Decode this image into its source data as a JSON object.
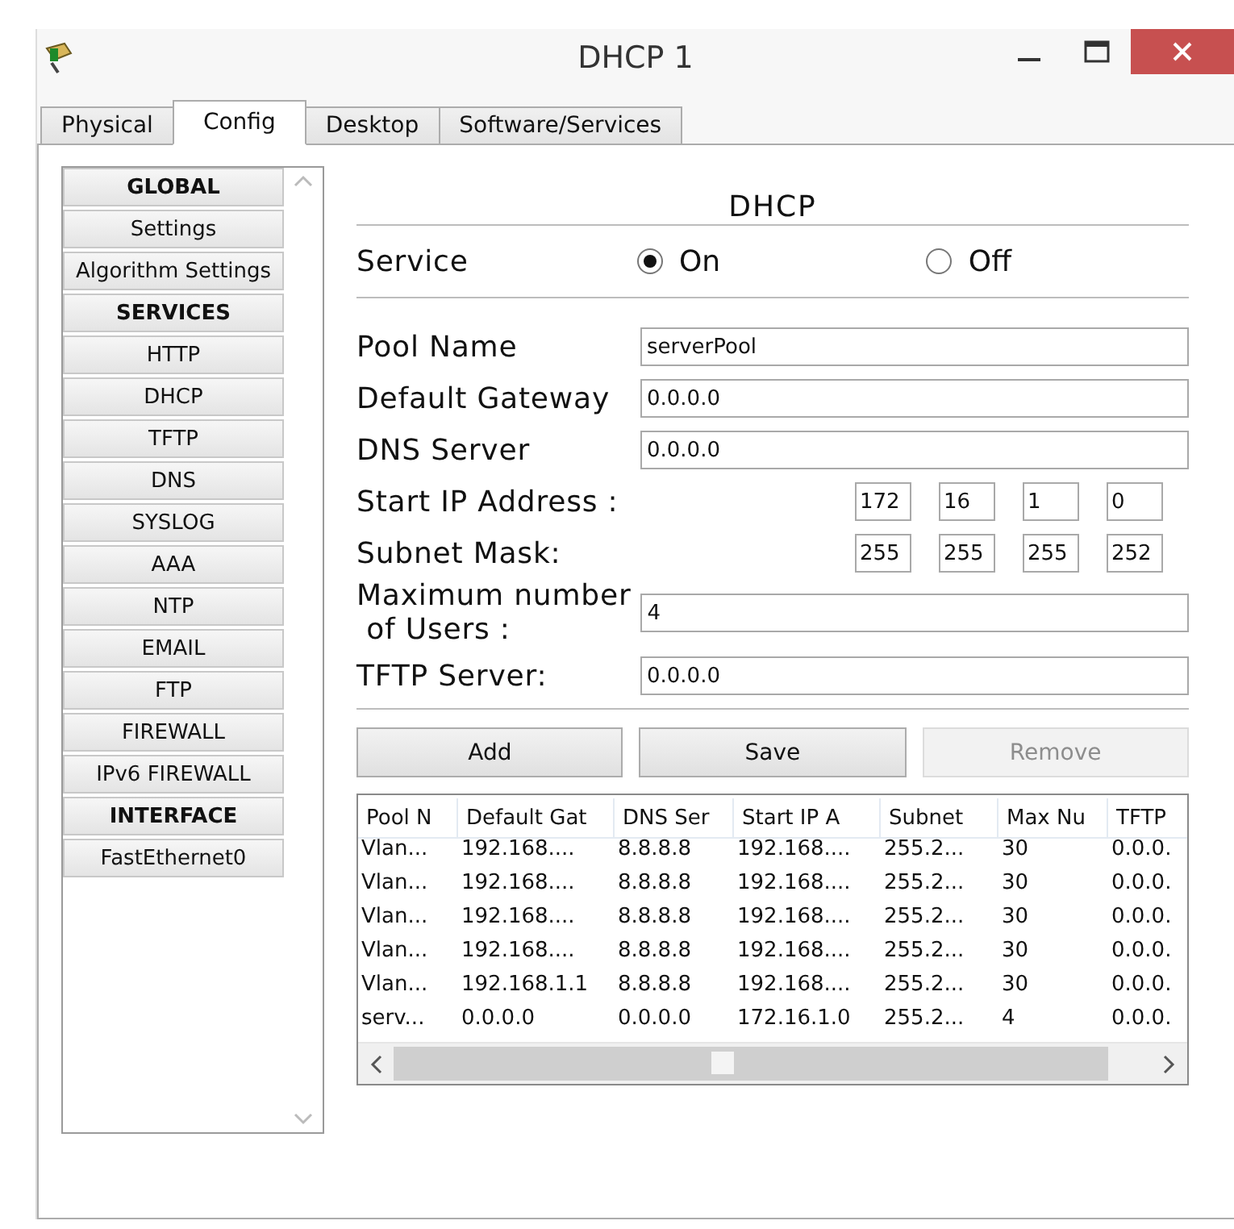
{
  "window": {
    "title": "DHCP 1"
  },
  "tabs": [
    {
      "label": "Physical",
      "selected": false
    },
    {
      "label": "Config",
      "selected": true
    },
    {
      "label": "Desktop",
      "selected": false
    },
    {
      "label": "Software/Services",
      "selected": false
    }
  ],
  "sidebar": {
    "items": [
      {
        "label": "GLOBAL",
        "kind": "header"
      },
      {
        "label": "Settings",
        "kind": "item"
      },
      {
        "label": "Algorithm Settings",
        "kind": "item"
      },
      {
        "label": "SERVICES",
        "kind": "header"
      },
      {
        "label": "HTTP",
        "kind": "item"
      },
      {
        "label": "DHCP",
        "kind": "item"
      },
      {
        "label": "TFTP",
        "kind": "item"
      },
      {
        "label": "DNS",
        "kind": "item"
      },
      {
        "label": "SYSLOG",
        "kind": "item"
      },
      {
        "label": "AAA",
        "kind": "item"
      },
      {
        "label": "NTP",
        "kind": "item"
      },
      {
        "label": "EMAIL",
        "kind": "item"
      },
      {
        "label": "FTP",
        "kind": "item"
      },
      {
        "label": "FIREWALL",
        "kind": "item"
      },
      {
        "label": "IPv6 FIREWALL",
        "kind": "item"
      },
      {
        "label": "INTERFACE",
        "kind": "header"
      },
      {
        "label": "FastEthernet0",
        "kind": "item"
      }
    ]
  },
  "panel": {
    "title": "DHCP",
    "service": {
      "label": "Service",
      "options": [
        {
          "label": "On",
          "selected": true
        },
        {
          "label": "Off",
          "selected": false
        }
      ]
    },
    "fields": [
      {
        "label": "Pool Name",
        "kind": "text",
        "value": "serverPool"
      },
      {
        "label": "Default Gateway",
        "kind": "text",
        "value": "0.0.0.0"
      },
      {
        "label": "DNS Server",
        "kind": "text",
        "value": "0.0.0.0"
      },
      {
        "label": "Start IP Address :",
        "kind": "ip",
        "octets": [
          "172",
          "16",
          "1",
          "0"
        ]
      },
      {
        "label": "Subnet Mask:",
        "kind": "ip",
        "octets": [
          "255",
          "255",
          "255",
          "252"
        ]
      },
      {
        "label": "Maximum number\n of Users :",
        "kind": "text",
        "value": "4"
      },
      {
        "label": "TFTP Server:",
        "kind": "text",
        "value": "0.0.0.0"
      }
    ],
    "buttons": [
      {
        "label": "Add",
        "disabled": false
      },
      {
        "label": "Save",
        "disabled": false
      },
      {
        "label": "Remove",
        "disabled": true
      }
    ],
    "table": {
      "columns": [
        "Pool N",
        "Default Gat",
        "DNS Ser",
        "Start IP A",
        "Subnet",
        "Max Nu",
        "TFTP"
      ],
      "rows": [
        [
          "Vlan...",
          "192.168....",
          "8.8.8.8",
          "192.168....",
          "255.2...",
          "30",
          "0.0.0."
        ],
        [
          "Vlan...",
          "192.168....",
          "8.8.8.8",
          "192.168....",
          "255.2...",
          "30",
          "0.0.0."
        ],
        [
          "Vlan...",
          "192.168....",
          "8.8.8.8",
          "192.168....",
          "255.2...",
          "30",
          "0.0.0."
        ],
        [
          "Vlan...",
          "192.168....",
          "8.8.8.8",
          "192.168....",
          "255.2...",
          "30",
          "0.0.0."
        ],
        [
          "Vlan...",
          "192.168.1.1",
          "8.8.8.8",
          "192.168....",
          "255.2...",
          "30",
          "0.0.0."
        ],
        [
          "serv...",
          "0.0.0.0",
          "0.0.0.0",
          "172.16.1.0",
          "255.2...",
          "4",
          "0.0.0."
        ]
      ]
    }
  }
}
